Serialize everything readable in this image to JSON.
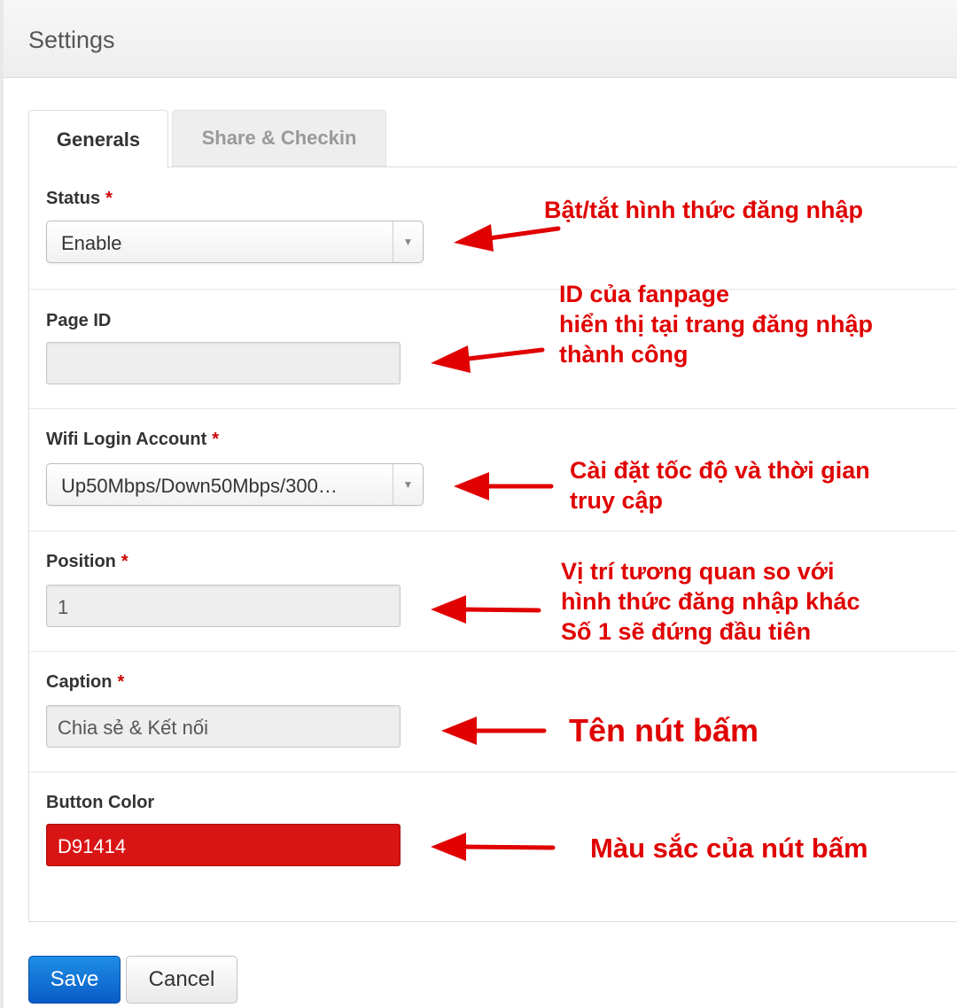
{
  "header": {
    "title": "Settings"
  },
  "tabs": [
    {
      "label": "Generals",
      "active": true
    },
    {
      "label": "Share & Checkin",
      "active": false
    }
  ],
  "form": {
    "status": {
      "label": "Status",
      "required_mark": "*",
      "value": "Enable"
    },
    "page_id": {
      "label": "Page ID",
      "value": ""
    },
    "wifi_login_account": {
      "label": "Wifi Login Account",
      "required_mark": "*",
      "value": "Up50Mbps/Down50Mbps/300…"
    },
    "position": {
      "label": "Position",
      "required_mark": "*",
      "value": "1"
    },
    "caption": {
      "label": "Caption",
      "required_mark": "*",
      "value": "Chia sẻ & Kết nối"
    },
    "button_color": {
      "label": "Button Color",
      "value": "D91414",
      "swatch": "#d91414"
    }
  },
  "annotations": {
    "status": [
      "Bật/tắt hình thức đăng nhập"
    ],
    "page_id": [
      "ID của fanpage",
      "hiển thị tại trang đăng nhập",
      "thành công"
    ],
    "wifi": [
      "Cài đặt tốc độ và thời gian",
      "truy cập"
    ],
    "position": [
      "Vị trí tương quan so với",
      "hình thức đăng nhập khác",
      "Số 1 sẽ đứng đầu tiên"
    ],
    "caption": [
      "Tên nút bấm"
    ],
    "button_color": [
      "Màu sắc của nút bấm"
    ]
  },
  "buttons": {
    "save": "Save",
    "cancel": "Cancel"
  },
  "colors": {
    "annotation": "#e00000",
    "primary": "#0a5cc6",
    "button_color": "#d91414"
  }
}
